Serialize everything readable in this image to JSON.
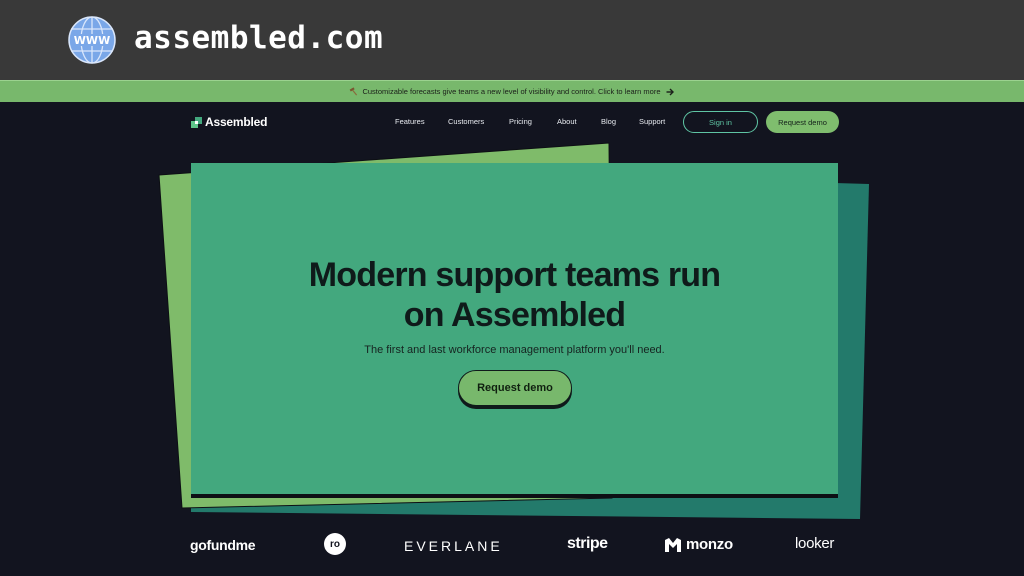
{
  "browser": {
    "url": "assembled.com",
    "globe_text": "WWW"
  },
  "banner": {
    "text": "Customizable forecasts give teams a new level of visibility and control. Click to learn more",
    "icon": "hammer-icon"
  },
  "nav": {
    "brand": "Assembled",
    "links": [
      "Features",
      "Customers",
      "Pricing",
      "About",
      "Blog",
      "Support"
    ],
    "sign_in": "Sign in",
    "request_demo": "Request demo"
  },
  "hero": {
    "title_line1": "Modern support teams run",
    "title_line2": "on Assembled",
    "subtitle": "The first and last workforce management platform you'll need.",
    "cta": "Request demo"
  },
  "customers": {
    "logos": [
      "gofundme",
      "ro",
      "EVERLANE",
      "stripe",
      "monzo",
      "looker"
    ]
  },
  "colors": {
    "background": "#12141f",
    "accent_green": "#78b86c",
    "hero_green": "#43a87e",
    "teal_back": "#237a6b",
    "teal_outline": "#5fc5a4"
  }
}
